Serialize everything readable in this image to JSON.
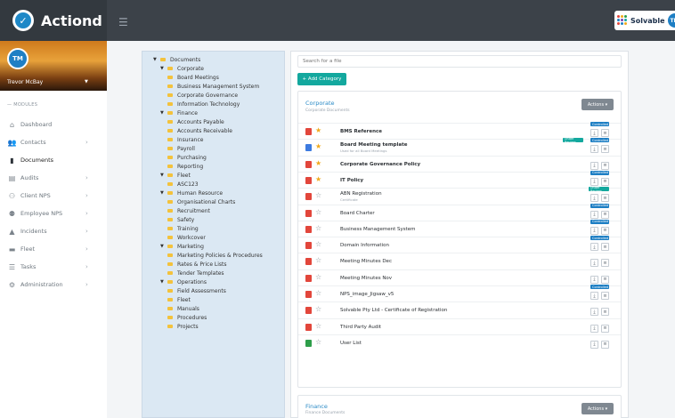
{
  "app": {
    "name": "Actiond",
    "partner": "Solvable",
    "user_initials": "TM"
  },
  "profile": {
    "initials": "TM",
    "name": "Trevor McBay"
  },
  "sidebar": {
    "section_label": "MODULES",
    "items": [
      {
        "label": "Dashboard",
        "icon": "home-icon",
        "has_chevron": false
      },
      {
        "label": "Contacts",
        "icon": "contacts-icon",
        "has_chevron": true
      },
      {
        "label": "Documents",
        "icon": "document-icon",
        "has_chevron": false,
        "active": true
      },
      {
        "label": "Audits",
        "icon": "clipboard-icon",
        "has_chevron": true
      },
      {
        "label": "Client NPS",
        "icon": "client-nps-icon",
        "has_chevron": true
      },
      {
        "label": "Employee NPS",
        "icon": "employee-nps-icon",
        "has_chevron": true
      },
      {
        "label": "Incidents",
        "icon": "warning-icon",
        "has_chevron": true
      },
      {
        "label": "Fleet",
        "icon": "truck-icon",
        "has_chevron": true
      },
      {
        "label": "Tasks",
        "icon": "tasks-icon",
        "has_chevron": true
      },
      {
        "label": "Administration",
        "icon": "cogs-icon",
        "has_chevron": true
      }
    ]
  },
  "tree": [
    {
      "label": "Documents",
      "level": 0,
      "expanded": true
    },
    {
      "label": "Corporate",
      "level": 1,
      "expanded": true
    },
    {
      "label": "Board Meetings",
      "level": 2
    },
    {
      "label": "Business Management System",
      "level": 2
    },
    {
      "label": "Corporate Governance",
      "level": 2
    },
    {
      "label": "Information Technology",
      "level": 2
    },
    {
      "label": "Finance",
      "level": 1,
      "expanded": true
    },
    {
      "label": "Accounts Payable",
      "level": 2
    },
    {
      "label": "Accounts Receivable",
      "level": 2
    },
    {
      "label": "Insurance",
      "level": 2
    },
    {
      "label": "Payroll",
      "level": 2
    },
    {
      "label": "Purchasing",
      "level": 2
    },
    {
      "label": "Reporting",
      "level": 2
    },
    {
      "label": "Fleet",
      "level": 1,
      "expanded": true
    },
    {
      "label": "ASC123",
      "level": 2
    },
    {
      "label": "Human Resource",
      "level": 1,
      "expanded": true
    },
    {
      "label": "Organisational Charts",
      "level": 2
    },
    {
      "label": "Recruitment",
      "level": 2
    },
    {
      "label": "Safety",
      "level": 2
    },
    {
      "label": "Training",
      "level": 2
    },
    {
      "label": "Workcover",
      "level": 2
    },
    {
      "label": "Marketing",
      "level": 1,
      "expanded": true
    },
    {
      "label": "Marketing Policies & Procedures",
      "level": 2
    },
    {
      "label": "Rates & Price Lists",
      "level": 2
    },
    {
      "label": "Tender Templates",
      "level": 2
    },
    {
      "label": "Operations",
      "level": 1,
      "expanded": true
    },
    {
      "label": "Field Assessments",
      "level": 2
    },
    {
      "label": "Fleet",
      "level": 2
    },
    {
      "label": "Manuals",
      "level": 2
    },
    {
      "label": "Procedures",
      "level": 2
    },
    {
      "label": "Projects",
      "level": 2
    }
  ],
  "search": {
    "placeholder": "Search for a file"
  },
  "add_category_label": "+ Add Category",
  "sections": [
    {
      "title": "Corporate",
      "subtitle": "Corporate Documents",
      "actions_label": "Actions ▾"
    },
    {
      "title": "Finance",
      "subtitle": "Finance Documents",
      "actions_label": "Actions ▾"
    }
  ],
  "documents": [
    {
      "name": "BMS Reference",
      "sub": "",
      "bold": true,
      "type": "pdf",
      "starred": true,
      "badges": [
        "Controlled"
      ]
    },
    {
      "name": "Board Meeting template",
      "sub": "Used for all Board Meetings",
      "bold": true,
      "type": "doc",
      "starred": true,
      "badges": [
        "Under Review",
        "Controlled"
      ]
    },
    {
      "name": "Corporate Governance Policy",
      "sub": "",
      "bold": true,
      "type": "pdf",
      "starred": true,
      "badges": []
    },
    {
      "name": "IT Policy",
      "sub": "",
      "bold": true,
      "type": "pdf",
      "starred": true,
      "badges": [
        "Controlled"
      ]
    },
    {
      "name": "ABN Registration",
      "sub": "Certificate",
      "bold": false,
      "type": "pdf",
      "starred": false,
      "badges": [
        "Under Review"
      ]
    },
    {
      "name": "Board Charter",
      "sub": "",
      "bold": false,
      "type": "pdf",
      "starred": false,
      "badges": [
        "Controlled"
      ]
    },
    {
      "name": "Business Management System",
      "sub": "",
      "bold": false,
      "type": "pdf",
      "starred": false,
      "badges": [
        "Controlled"
      ]
    },
    {
      "name": "Domain Information",
      "sub": "",
      "bold": false,
      "type": "pdf",
      "starred": false,
      "badges": [
        "Controlled"
      ]
    },
    {
      "name": "Meeting Minutes Dec",
      "sub": "",
      "bold": false,
      "type": "pdf",
      "starred": false,
      "badges": []
    },
    {
      "name": "Meeting Minutes Nov",
      "sub": "",
      "bold": false,
      "type": "pdf",
      "starred": false,
      "badges": []
    },
    {
      "name": "NPS_image_Jigsaw_v5",
      "sub": "",
      "bold": false,
      "type": "img",
      "starred": false,
      "badges": [
        "Controlled"
      ]
    },
    {
      "name": "Solvable Pty Ltd - Certificate of Registration",
      "sub": "",
      "bold": false,
      "type": "pdf",
      "starred": false,
      "badges": []
    },
    {
      "name": "Third Party Audit",
      "sub": "",
      "bold": false,
      "type": "pdf",
      "starred": false,
      "badges": []
    },
    {
      "name": "User List",
      "sub": "",
      "bold": false,
      "type": "xls",
      "starred": false,
      "badges": []
    }
  ],
  "colors": {
    "accent": "#13a89e",
    "link": "#2a8ac6",
    "controlled": "#1e7fc4",
    "star": "#f1a91b",
    "pdf": "#e2463b",
    "doc": "#3d7be0",
    "xls": "#2e9e4a"
  }
}
